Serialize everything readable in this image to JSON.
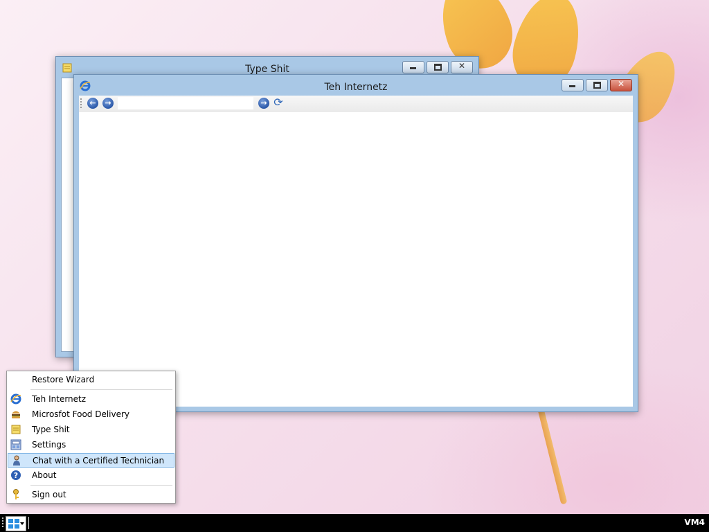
{
  "windows": {
    "editor": {
      "title": "Type Shit",
      "icon": "notepad-icon"
    },
    "browser": {
      "title": "Teh Internetz",
      "icon": "internet-explorer-icon",
      "address_value": "",
      "toolbar": {
        "back_icon": "back-arrow-icon",
        "forward_icon": "forward-arrow-icon",
        "go_icon": "go-arrow-icon",
        "refresh_icon": "refresh-icon"
      }
    }
  },
  "start_menu": {
    "items": [
      {
        "label": "Restore Wizard",
        "icon": ""
      },
      {
        "label": "Teh Internetz",
        "icon": "internet-explorer-icon"
      },
      {
        "label": "Microsfot Food Delivery",
        "icon": "burger-icon"
      },
      {
        "label": "Type Shit",
        "icon": "notepad-icon"
      },
      {
        "label": "Settings",
        "icon": "settings-icon"
      },
      {
        "label": "Chat with a Certified Technician",
        "icon": "technician-icon",
        "selected": true
      },
      {
        "label": "About",
        "icon": "help-icon"
      },
      {
        "label": "Sign out",
        "icon": "key-icon"
      }
    ]
  },
  "taskbar": {
    "clock": "VM4",
    "start_icon": "windows-logo-icon"
  },
  "colors": {
    "title_bar": "#a9c8e6",
    "selection": "#cfe6fb",
    "close_button": "#c8513c",
    "taskbar": "#000000"
  }
}
